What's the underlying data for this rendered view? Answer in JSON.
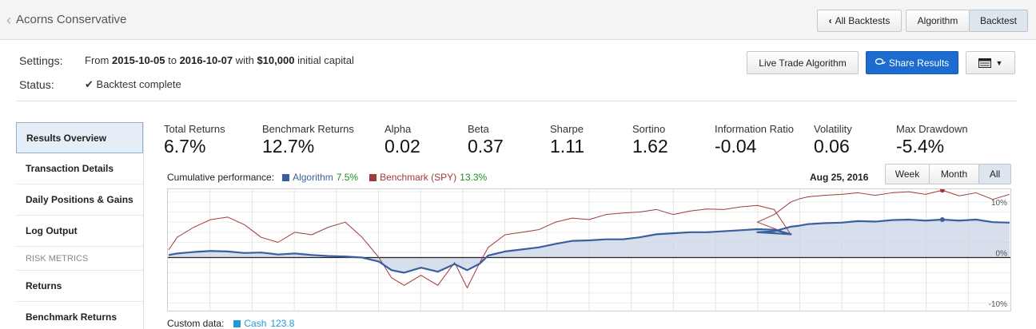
{
  "header": {
    "back_label": "Acorns Conservative",
    "buttons": {
      "all_backtests": "All Backtests",
      "algorithm": "Algorithm",
      "backtest": "Backtest"
    }
  },
  "settings": {
    "settings_label": "Settings:",
    "from_word": "From",
    "start_date": "2015-10-05",
    "to_word": "to",
    "end_date": "2016-10-07",
    "with_word": "with",
    "capital": "$10,000",
    "capital_suffix": "initial capital",
    "status_label": "Status:",
    "status_value": "Backtest complete"
  },
  "actions": {
    "live_trade": "Live Trade Algorithm",
    "share_results": "Share Results"
  },
  "sidebar": {
    "items": [
      {
        "label": "Results Overview",
        "active": true
      },
      {
        "label": "Transaction Details"
      },
      {
        "label": "Daily Positions & Gains"
      },
      {
        "label": "Log Output"
      }
    ],
    "section_label": "RISK METRICS",
    "risk_items": [
      {
        "label": "Returns"
      },
      {
        "label": "Benchmark Returns"
      }
    ]
  },
  "metrics": [
    {
      "label": "Total Returns",
      "value": "6.7%"
    },
    {
      "label": "Benchmark Returns",
      "value": "12.7%"
    },
    {
      "label": "Alpha",
      "value": "0.02"
    },
    {
      "label": "Beta",
      "value": "0.37"
    },
    {
      "label": "Sharpe",
      "value": "1.11"
    },
    {
      "label": "Sortino",
      "value": "1.62"
    },
    {
      "label": "Information Ratio",
      "value": "-0.04"
    },
    {
      "label": "Volatility",
      "value": "0.06"
    },
    {
      "label": "Max Drawdown",
      "value": "-5.4%"
    }
  ],
  "chart_header": {
    "label": "Cumulative performance:",
    "algo_name": "Algorithm",
    "algo_value": "7.5%",
    "bench_name": "Benchmark (SPY)",
    "bench_value": "13.3%",
    "hover_date": "Aug 25, 2016",
    "range_buttons": [
      "Week",
      "Month",
      "All"
    ],
    "active_range": "All"
  },
  "custom_data": {
    "label": "Custom data:",
    "series_name": "Cash",
    "series_value": "123.8"
  },
  "colors": {
    "algorithm": "#3a5f9f",
    "benchmark": "#a33a3a",
    "cash": "#1e9ad6",
    "positive": "#1e8c2a"
  },
  "chart_data": {
    "type": "line",
    "ylabel": "",
    "xlabel": "",
    "y_ticks": [
      "10%",
      "0%",
      "-10%"
    ],
    "y_tick_values": [
      10,
      0,
      -10
    ],
    "ylim": [
      -10.5,
      13.5
    ],
    "x": [
      0,
      0.01,
      0.03,
      0.05,
      0.07,
      0.09,
      0.11,
      0.13,
      0.15,
      0.17,
      0.19,
      0.21,
      0.23,
      0.25,
      0.265,
      0.28,
      0.3,
      0.32,
      0.34,
      0.355,
      0.37,
      0.38,
      0.4,
      0.42,
      0.44,
      0.46,
      0.48,
      0.5,
      0.52,
      0.54,
      0.56,
      0.58,
      0.6,
      0.62,
      0.64,
      0.66,
      0.68,
      0.7,
      0.72,
      0.74,
      0.7,
      0.72,
      0.74,
      0.75,
      0.76,
      0.78,
      0.8,
      0.82,
      0.84,
      0.86,
      0.88,
      0.9,
      0.92,
      0.94,
      0.96,
      0.98,
      1.0
    ],
    "series": [
      {
        "name": "Algorithm",
        "values": [
          0.5,
          0.8,
          1.1,
          1.3,
          1.2,
          0.9,
          1.0,
          0.6,
          0.8,
          0.5,
          0.3,
          0.2,
          0.0,
          -0.8,
          -2.5,
          -3.0,
          -2.0,
          -2.8,
          -1.3,
          -2.5,
          -1.2,
          0.4,
          1.2,
          1.6,
          2.0,
          2.7,
          3.3,
          3.4,
          3.6,
          3.6,
          4.0,
          4.6,
          4.8,
          5.0,
          5.0,
          5.2,
          5.4,
          5.6,
          5.5,
          4.6,
          5.0,
          5.2,
          6.1,
          6.3,
          6.6,
          6.8,
          6.9,
          7.2,
          7.1,
          7.4,
          7.5,
          7.3,
          7.5,
          7.3,
          7.5,
          7.0,
          6.9
        ]
      },
      {
        "name": "Benchmark (SPY)",
        "values": [
          1.5,
          4.0,
          6.0,
          7.5,
          8.0,
          6.5,
          4.0,
          3.0,
          5.0,
          4.5,
          6.0,
          7.0,
          4.0,
          0.0,
          -4.0,
          -5.5,
          -3.5,
          -5.5,
          -1.0,
          -6.0,
          -1.0,
          2.0,
          4.5,
          5.0,
          5.5,
          7.0,
          7.8,
          7.5,
          8.5,
          8.8,
          9.0,
          9.5,
          8.5,
          9.2,
          9.6,
          9.5,
          10.0,
          10.3,
          9.5,
          4.5,
          7.0,
          8.5,
          11.0,
          11.6,
          12.0,
          12.3,
          12.5,
          12.8,
          12.3,
          12.8,
          13.0,
          12.5,
          13.3,
          12.2,
          12.8,
          11.5,
          12.5
        ]
      }
    ]
  }
}
